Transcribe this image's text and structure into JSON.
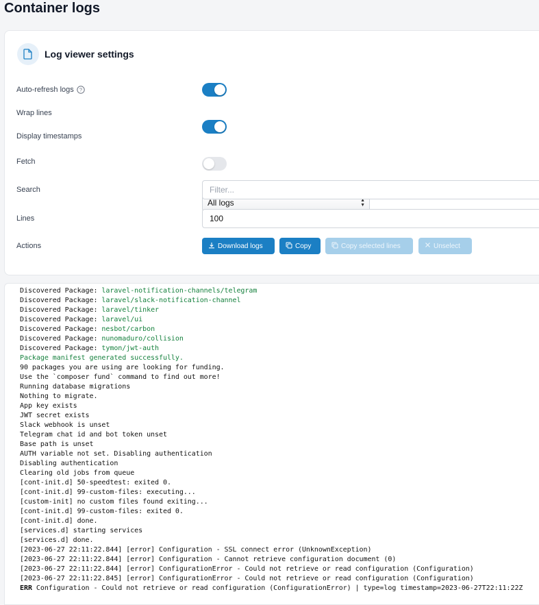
{
  "page": {
    "title": "Container logs"
  },
  "settings": {
    "title": "Log viewer settings",
    "auto_refresh": {
      "label": "Auto-refresh logs",
      "enabled": true
    },
    "wrap_lines": {
      "label": "Wrap lines",
      "enabled": true
    },
    "timestamps": {
      "label": "Display timestamps",
      "enabled": false
    },
    "fetch": {
      "label": "Fetch",
      "value": "All logs"
    },
    "search": {
      "label": "Search",
      "placeholder": "Filter..."
    },
    "lines": {
      "label": "Lines",
      "value": "100"
    },
    "actions": {
      "label": "Actions",
      "download": "Download logs",
      "copy": "Copy",
      "copy_selected": "Copy selected lines",
      "unselect": "Unselect"
    }
  },
  "colors": {
    "primary": "#1b7fc4",
    "disabled": "#a6cfea",
    "success_text": "#15803d"
  },
  "logs": {
    "packages_prefix": "Discovered Package: ",
    "packages": [
      "laravel-notification-channels/telegram",
      "laravel/slack-notification-channel",
      "laravel/tinker",
      "laravel/ui",
      "nesbot/carbon",
      "nunomaduro/collision",
      "tymon/jwt-auth"
    ],
    "manifest": "Package manifest generated successfully.",
    "lines": [
      "90 packages you are using are looking for funding.",
      "Use the `composer fund` command to find out more!",
      "Running database migrations",
      "Nothing to migrate.",
      "App key exists",
      "JWT secret exists",
      "Slack webhook is unset",
      "Telegram chat id and bot token unset",
      "Base path is unset",
      "AUTH variable not set. Disabling authentication",
      "Disabling authentication",
      "Clearing old jobs from queue",
      "[cont-init.d] 50-speedtest: exited 0.",
      "[cont-init.d] 99-custom-files: executing...",
      "[custom-init] no custom files found exiting...",
      "[cont-init.d] 99-custom-files: exited 0.",
      "[cont-init.d] done.",
      "[services.d] starting services",
      "[services.d] done.",
      "[2023-06-27 22:11:22.844] [error] Configuration - SSL connect error (UnknownException)",
      "[2023-06-27 22:11:22.844] [error] Configuration - Cannot retrieve configuration document (0)",
      "[2023-06-27 22:11:22.844] [error] ConfigurationError - Could not retrieve or read configuration (Configuration)",
      "[2023-06-27 22:11:22.845] [error] ConfigurationError - Could not retrieve or read configuration (Configuration)"
    ],
    "final": {
      "tag": "ERR",
      "text": " Configuration - Could not retrieve or read configuration (ConfigurationError) | type=log timestamp=2023-06-27T22:11:22Z"
    }
  }
}
